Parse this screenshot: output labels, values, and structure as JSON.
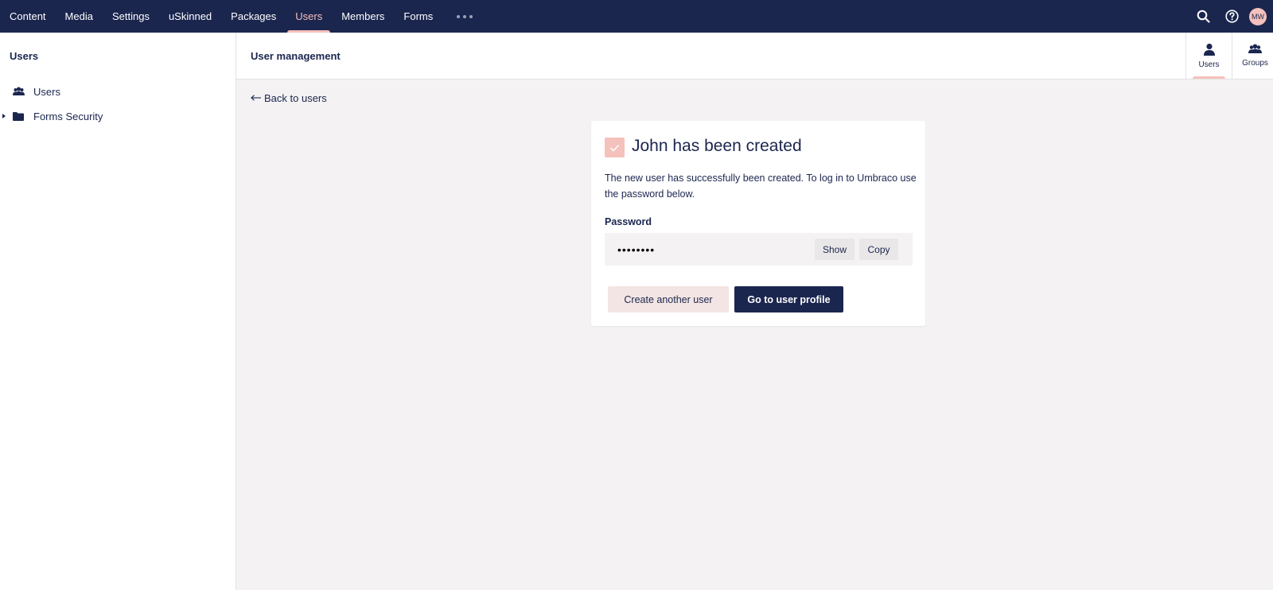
{
  "topnav": {
    "items": [
      {
        "label": "Content",
        "active": false
      },
      {
        "label": "Media",
        "active": false
      },
      {
        "label": "Settings",
        "active": false
      },
      {
        "label": "uSkinned",
        "active": false
      },
      {
        "label": "Packages",
        "active": false
      },
      {
        "label": "Users",
        "active": true
      },
      {
        "label": "Members",
        "active": false
      },
      {
        "label": "Forms",
        "active": false
      }
    ],
    "more_icon": "ellipsis-icon",
    "search_icon": "search-icon",
    "help_icon": "help-icon",
    "avatar_initials": "MW"
  },
  "sidebar": {
    "title": "Users",
    "items": [
      {
        "label": "Users",
        "icon": "users-icon"
      },
      {
        "label": "Forms Security",
        "icon": "folder-icon"
      }
    ]
  },
  "header": {
    "title": "User management",
    "tabs": [
      {
        "label": "Users",
        "icon": "user-icon",
        "active": true
      },
      {
        "label": "Groups",
        "icon": "groups-icon",
        "active": false
      }
    ]
  },
  "main": {
    "back_link": "Back to users",
    "card": {
      "title": "John has been created",
      "description": "The new user has successfully been created. To log in to Umbraco use the password below.",
      "password_label": "Password",
      "password_value": "••••••••",
      "show_label": "Show",
      "copy_label": "Copy",
      "create_another_label": "Create another user",
      "go_to_profile_label": "Go to user profile"
    }
  },
  "colors": {
    "navy": "#1b264f",
    "accent": "#f5c1bc",
    "background": "#f4f2f2"
  }
}
